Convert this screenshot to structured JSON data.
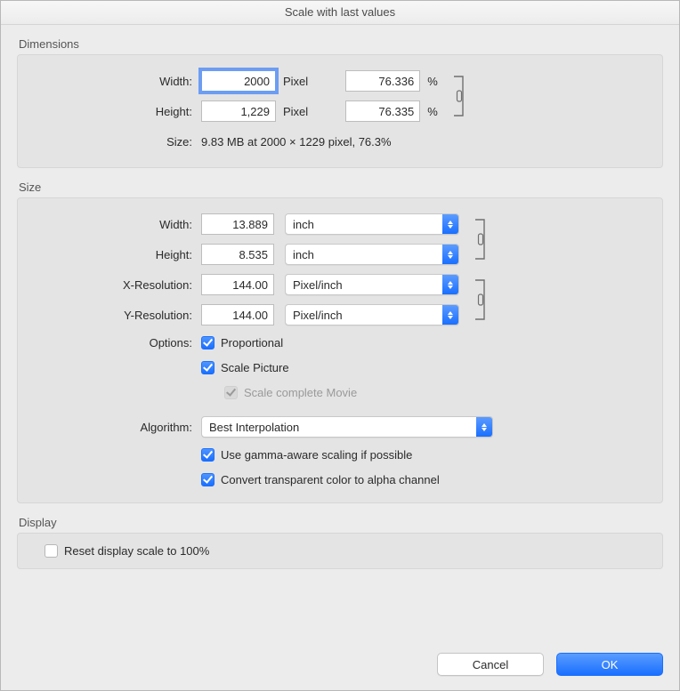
{
  "window": {
    "title": "Scale with last values"
  },
  "dimensions": {
    "group_label": "Dimensions",
    "width_label": "Width:",
    "height_label": "Height:",
    "width_px": "2000",
    "height_px": "1,229",
    "pixel_unit": "Pixel",
    "width_pct": "76.336",
    "height_pct": "76.335",
    "pct_sign": "%",
    "size_label": "Size:",
    "size_text": "9.83 MB at 2000 × 1229 pixel, 76.3%"
  },
  "size": {
    "group_label": "Size",
    "width_label": "Width:",
    "height_label": "Height:",
    "width_val": "13.889",
    "height_val": "8.535",
    "unit_select": "inch",
    "xres_label": "X-Resolution:",
    "yres_label": "Y-Resolution:",
    "xres_val": "144.00",
    "yres_val": "144.00",
    "res_unit_select": "Pixel/inch",
    "options_label": "Options:",
    "proportional_label": "Proportional",
    "scale_picture_label": "Scale Picture",
    "scale_movie_label": "Scale complete Movie",
    "algorithm_label": "Algorithm:",
    "algorithm_select": "Best Interpolation",
    "gamma_label": "Use gamma-aware scaling if possible",
    "alpha_label": "Convert transparent color to alpha channel"
  },
  "display": {
    "group_label": "Display",
    "reset_label": "Reset display scale to 100%"
  },
  "buttons": {
    "cancel": "Cancel",
    "ok": "OK"
  }
}
